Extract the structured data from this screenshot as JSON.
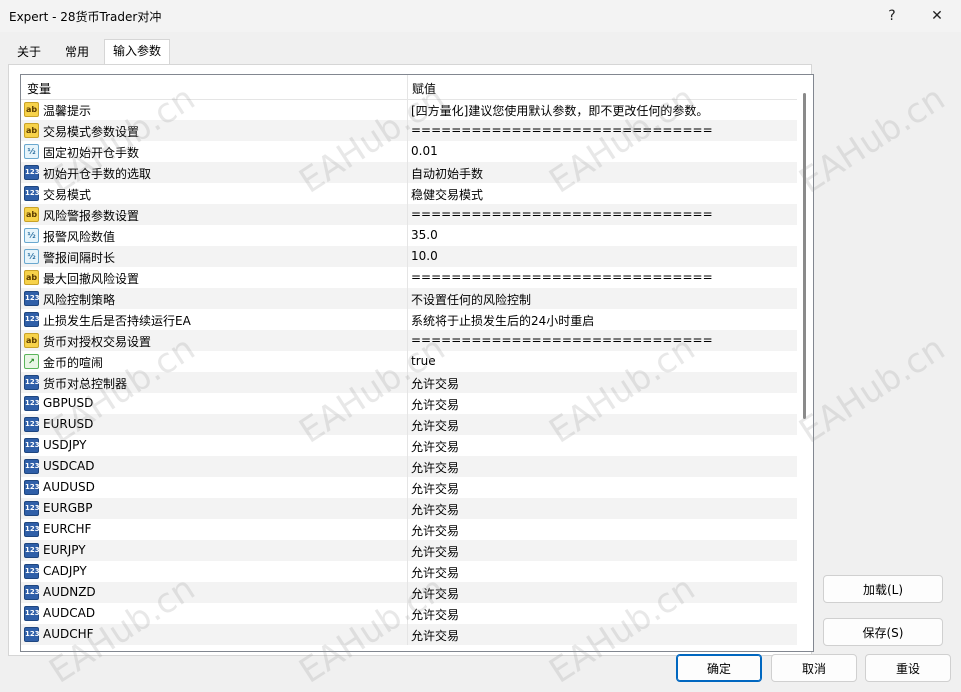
{
  "window": {
    "title": "Expert - 28货币Trader对冲",
    "help": "?",
    "close": "✕"
  },
  "tabs": [
    {
      "label": "关于"
    },
    {
      "label": "常用"
    },
    {
      "label": "输入参数"
    }
  ],
  "table": {
    "headers": {
      "variable": "变量",
      "value": "赋值"
    },
    "rows": [
      {
        "type": "str",
        "icon": "ab",
        "name": "温馨提示",
        "value": "[四方量化]建议您使用默认参数，即不更改任何的参数。"
      },
      {
        "type": "str",
        "icon": "ab",
        "name": "交易模式参数设置",
        "value": "=============================="
      },
      {
        "type": "dbl",
        "icon": "½",
        "name": "固定初始开仓手数",
        "value": "0.01"
      },
      {
        "type": "int",
        "icon": "123",
        "name": "初始开仓手数的选取",
        "value": "自动初始手数"
      },
      {
        "type": "int",
        "icon": "123",
        "name": "交易模式",
        "value": "稳健交易模式"
      },
      {
        "type": "str",
        "icon": "ab",
        "name": "风险警报参数设置",
        "value": "=============================="
      },
      {
        "type": "dbl",
        "icon": "½",
        "name": "报警风险数值",
        "value": "35.0"
      },
      {
        "type": "dbl",
        "icon": "½",
        "name": "警报间隔时长",
        "value": "10.0"
      },
      {
        "type": "str",
        "icon": "ab",
        "name": "最大回撤风险设置",
        "value": "=============================="
      },
      {
        "type": "int",
        "icon": "123",
        "name": "风险控制策略",
        "value": "不设置任何的风险控制"
      },
      {
        "type": "int",
        "icon": "123",
        "name": "止损发生后是否持续运行EA",
        "value": "系统将于止损发生后的24小时重启"
      },
      {
        "type": "str",
        "icon": "ab",
        "name": "货币对授权交易设置",
        "value": "=============================="
      },
      {
        "type": "bool",
        "icon": "↗",
        "name": "金币的喧闹",
        "value": "true"
      },
      {
        "type": "int",
        "icon": "123",
        "name": "货币对总控制器",
        "value": "允许交易"
      },
      {
        "type": "int",
        "icon": "123",
        "name": "GBPUSD",
        "value": "允许交易"
      },
      {
        "type": "int",
        "icon": "123",
        "name": "EURUSD",
        "value": "允许交易"
      },
      {
        "type": "int",
        "icon": "123",
        "name": "USDJPY",
        "value": "允许交易"
      },
      {
        "type": "int",
        "icon": "123",
        "name": "USDCAD",
        "value": "允许交易"
      },
      {
        "type": "int",
        "icon": "123",
        "name": "AUDUSD",
        "value": "允许交易"
      },
      {
        "type": "int",
        "icon": "123",
        "name": "EURGBP",
        "value": "允许交易"
      },
      {
        "type": "int",
        "icon": "123",
        "name": "EURCHF",
        "value": "允许交易"
      },
      {
        "type": "int",
        "icon": "123",
        "name": "EURJPY",
        "value": "允许交易"
      },
      {
        "type": "int",
        "icon": "123",
        "name": "CADJPY",
        "value": "允许交易"
      },
      {
        "type": "int",
        "icon": "123",
        "name": "AUDNZD",
        "value": "允许交易"
      },
      {
        "type": "int",
        "icon": "123",
        "name": "AUDCAD",
        "value": "允许交易"
      },
      {
        "type": "int",
        "icon": "123",
        "name": "AUDCHF",
        "value": "允许交易"
      }
    ]
  },
  "side_buttons": {
    "load": "加载(L)",
    "save": "保存(S)"
  },
  "footer_buttons": {
    "ok": "确定",
    "cancel": "取消",
    "reset": "重设"
  },
  "watermark": "EAHub.cn",
  "colors": {
    "accent": "#0067c0",
    "alt_row": "#f3f3f3"
  }
}
